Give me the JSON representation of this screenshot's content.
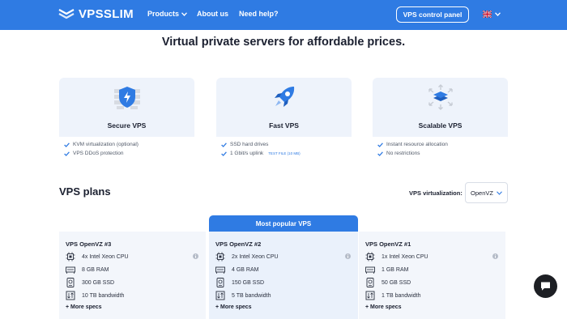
{
  "header": {
    "logo": "VPSSLIM",
    "nav": {
      "products": "Products",
      "about": "About us",
      "help": "Need help?"
    },
    "control_panel": "VPS control panel",
    "accent": "#2f7be3"
  },
  "page_title": "Virtual private servers for affordable prices.",
  "features": [
    {
      "title": "Secure VPS",
      "icon": "shield-lightning-icon",
      "items": [
        "KVM virtualization (optional)",
        "VPS DDoS protection"
      ]
    },
    {
      "title": "Fast VPS",
      "icon": "rocket-icon",
      "items": [
        "SSD hard drives",
        "1 Gbit/s uplink"
      ],
      "link": "TEST FILE (10 MB)"
    },
    {
      "title": "Scalable VPS",
      "icon": "stack-arrows-icon",
      "items": [
        "Instant resource allocation",
        "No restrictions"
      ]
    }
  ],
  "plans_section": {
    "title": "VPS plans",
    "virt_label": "VPS virtualization:",
    "virt_value": "OpenVZ",
    "popular_badge": "Most popular VPS"
  },
  "plans": [
    {
      "name": "VPS OpenVZ #3",
      "cpu": "4x Intel Xeon CPU",
      "ram": "8 GB RAM",
      "disk": "300 GB SSD",
      "bandwidth": "10 TB bandwidth",
      "more": "+ More specs"
    },
    {
      "name": "VPS OpenVZ #2",
      "cpu": "2x Intel Xeon CPU",
      "ram": "4 GB RAM",
      "disk": "150 GB SSD",
      "bandwidth": "5 TB bandwidth",
      "more": "+ More specs"
    },
    {
      "name": "VPS OpenVZ #1",
      "cpu": "1x Intel Xeon CPU",
      "ram": "1 GB RAM",
      "disk": "50 GB SSD",
      "bandwidth": "1 TB bandwidth",
      "more": "+ More specs"
    }
  ]
}
